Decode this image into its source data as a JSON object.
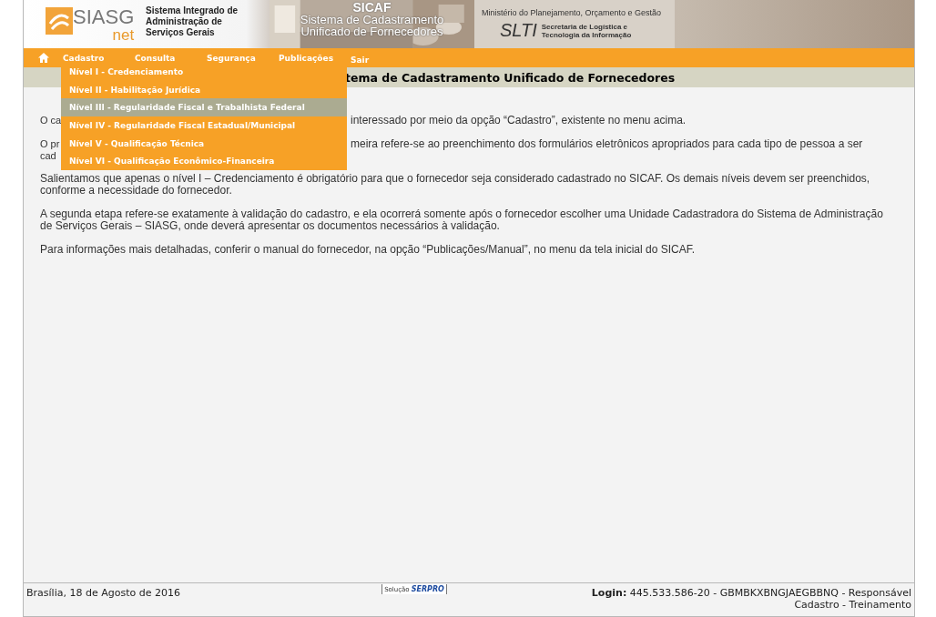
{
  "header": {
    "logo": {
      "word": "SIASG",
      "sub": "net"
    },
    "system_name": [
      "Sistema Integrado de",
      "Administração de",
      "Serviços Gerais"
    ],
    "product": {
      "acronym": "SICAF",
      "lines": [
        "Sistema de Cadastramento",
        "Unificado de Fornecedores"
      ]
    },
    "ministry": "Ministério do Planejamento, Orçamento e Gestão",
    "secretariat": {
      "acronym": "SLTI",
      "lines": [
        "Secretaria de Logística e",
        "Tecnologia da Informação"
      ]
    }
  },
  "menu": [
    {
      "label": "Cadastro"
    },
    {
      "label": "Consulta"
    },
    {
      "label": "Segurança"
    },
    {
      "label": "Publicações"
    },
    {
      "label": "Sair"
    }
  ],
  "dropdown": [
    {
      "label": "Nível I - Credenciamento",
      "selected": false
    },
    {
      "label": "Nível II - Habilitação Jurídica",
      "selected": false
    },
    {
      "label": "Nível III - Regularidade Fiscal e Trabalhista Federal",
      "selected": true
    },
    {
      "label": "Nível IV - Regularidade Fiscal Estadual/Municipal",
      "selected": false
    },
    {
      "label": "Nível V - Qualificação Técnica",
      "selected": false
    },
    {
      "label": "Nível VI - Qualificação Econômico-Financeira",
      "selected": false
    }
  ],
  "page_title": "tema de Cadastramento Unificado de Fornecedores",
  "paragraphs": [
    {
      "lines": [
        {
          "left": "O ca",
          "right": "interessado por meio da opção “Cadastro”, existente no menu acima."
        }
      ]
    },
    {
      "lines": [
        {
          "left": "O pr",
          "right": "meira refere-se ao preenchimento dos formulários eletrônicos apropriados para cada tipo de pessoa a ser"
        },
        {
          "left": "cad"
        }
      ]
    },
    {
      "text": "Salientamos que apenas o nível I – Credenciamento é obrigatório para que o fornecedor seja considerado cadastrado no SICAF. Os demais níveis devem ser preenchidos, conforme a necessidade do fornecedor."
    },
    {
      "text": "A segunda etapa refere-se exatamente à validação do cadastro, e ela ocorrerá somente após o fornecedor escolher uma Unidade Cadastradora do Sistema de Administração de Serviços Gerais – SIASG, onde deverá apresentar os documentos necessários à validação."
    },
    {
      "text": "Para informações mais detalhadas, conferir o manual do fornecedor, na opção “Publicações/Manual”, no menu da tela inicial do SICAF."
    }
  ],
  "footer": {
    "date": "Brasília, 18 de Agosto de 2016",
    "badge": {
      "caption": "Solução",
      "brand": "SERPRO"
    },
    "login": [
      "**Login:** 445.533.586-20 - GBMBKXBNGJAEGBBNQ - Responsável",
      "Cadastro - Treinamento"
    ]
  }
}
